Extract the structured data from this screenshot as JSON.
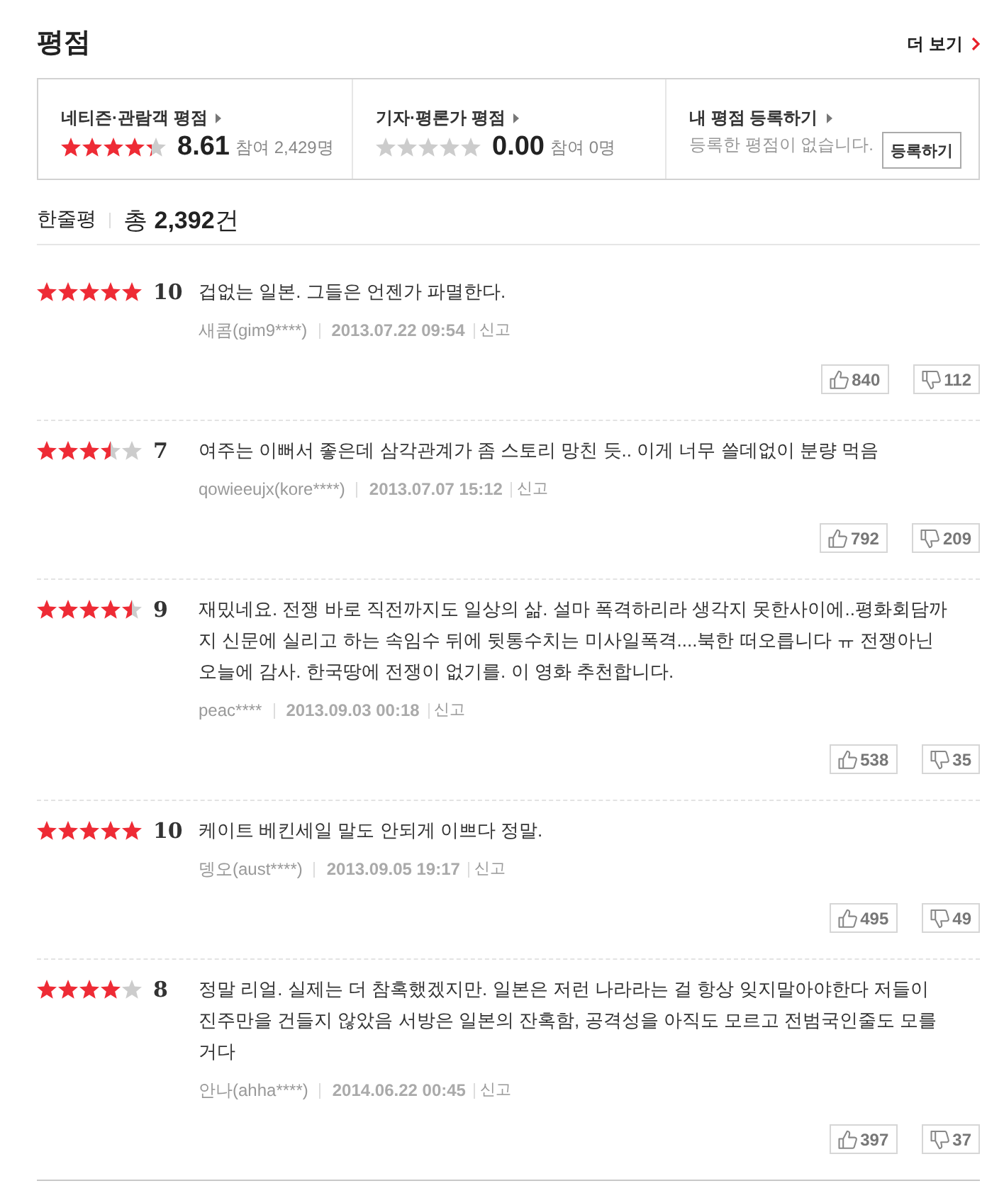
{
  "header": {
    "title": "평점",
    "more_link": "더 보기"
  },
  "summary": [
    {
      "kind": "rating",
      "label": "네티즌·관람객 평점",
      "stars": 4.3,
      "score": "8.61",
      "participants": "참여 2,429명"
    },
    {
      "kind": "rating",
      "label": "기자·평론가 평점",
      "stars": 0,
      "score": "0.00",
      "participants": "참여 0명"
    },
    {
      "kind": "register",
      "label": "내 평점 등록하기",
      "message": "등록한 평점이 없습니다.",
      "button": "등록하기"
    }
  ],
  "reviews_header": {
    "title": "한줄평",
    "total": "총 **2,392**건"
  },
  "reviews": [
    {
      "stars": 5,
      "score": "10",
      "text": "겁없는 일본. 그들은 언젠가 파멸한다.",
      "user": "새콤(gim9****)",
      "date": "2013.07.22 09:54",
      "report": "신고",
      "likes": "840",
      "dislikes": "112"
    },
    {
      "stars": 3.5,
      "score": "7",
      "text": "여주는 이뻐서 좋은데 삼각관계가 좀 스토리 망친 듯.. 이게 너무 쓸데없이 분량 먹음",
      "user": "qowieeujx(kore****)",
      "date": "2013.07.07 15:12",
      "report": "신고",
      "likes": "792",
      "dislikes": "209"
    },
    {
      "stars": 4.5,
      "score": "9",
      "text": "재밌네요. 전쟁 바로 직전까지도 일상의 삶. 설마 폭격하리라 생각지 못한사이에..평화회담까지 신문에 실리고 하는 속임수 뒤에 뒷통수치는 미사일폭격....북한 떠오릅니다 ㅠ 전쟁아닌 오늘에 감사. 한국땅에 전쟁이 없기를. 이 영화 추천합니다.",
      "user": "peac****",
      "date": "2013.09.03 00:18",
      "report": "신고",
      "likes": "538",
      "dislikes": "35"
    },
    {
      "stars": 5,
      "score": "10",
      "text": "케이트 베킨세일 말도 안되게 이쁘다 정말.",
      "user": "뎅오(aust****)",
      "date": "2013.09.05 19:17",
      "report": "신고",
      "likes": "495",
      "dislikes": "49"
    },
    {
      "stars": 4,
      "score": "8",
      "text": "정말 리얼. 실제는 더 참혹했겠지만. 일본은 저런 나라라는 걸 항상 잊지말아야한다 저들이 진주만을 건들지 않았음 서방은 일본의 잔혹함, 공격성을 아직도 모르고 전범국인줄도 모를 거다",
      "user": "안나(ahha****)",
      "date": "2014.06.22 00:45",
      "report": "신고",
      "likes": "397",
      "dislikes": "37"
    }
  ]
}
